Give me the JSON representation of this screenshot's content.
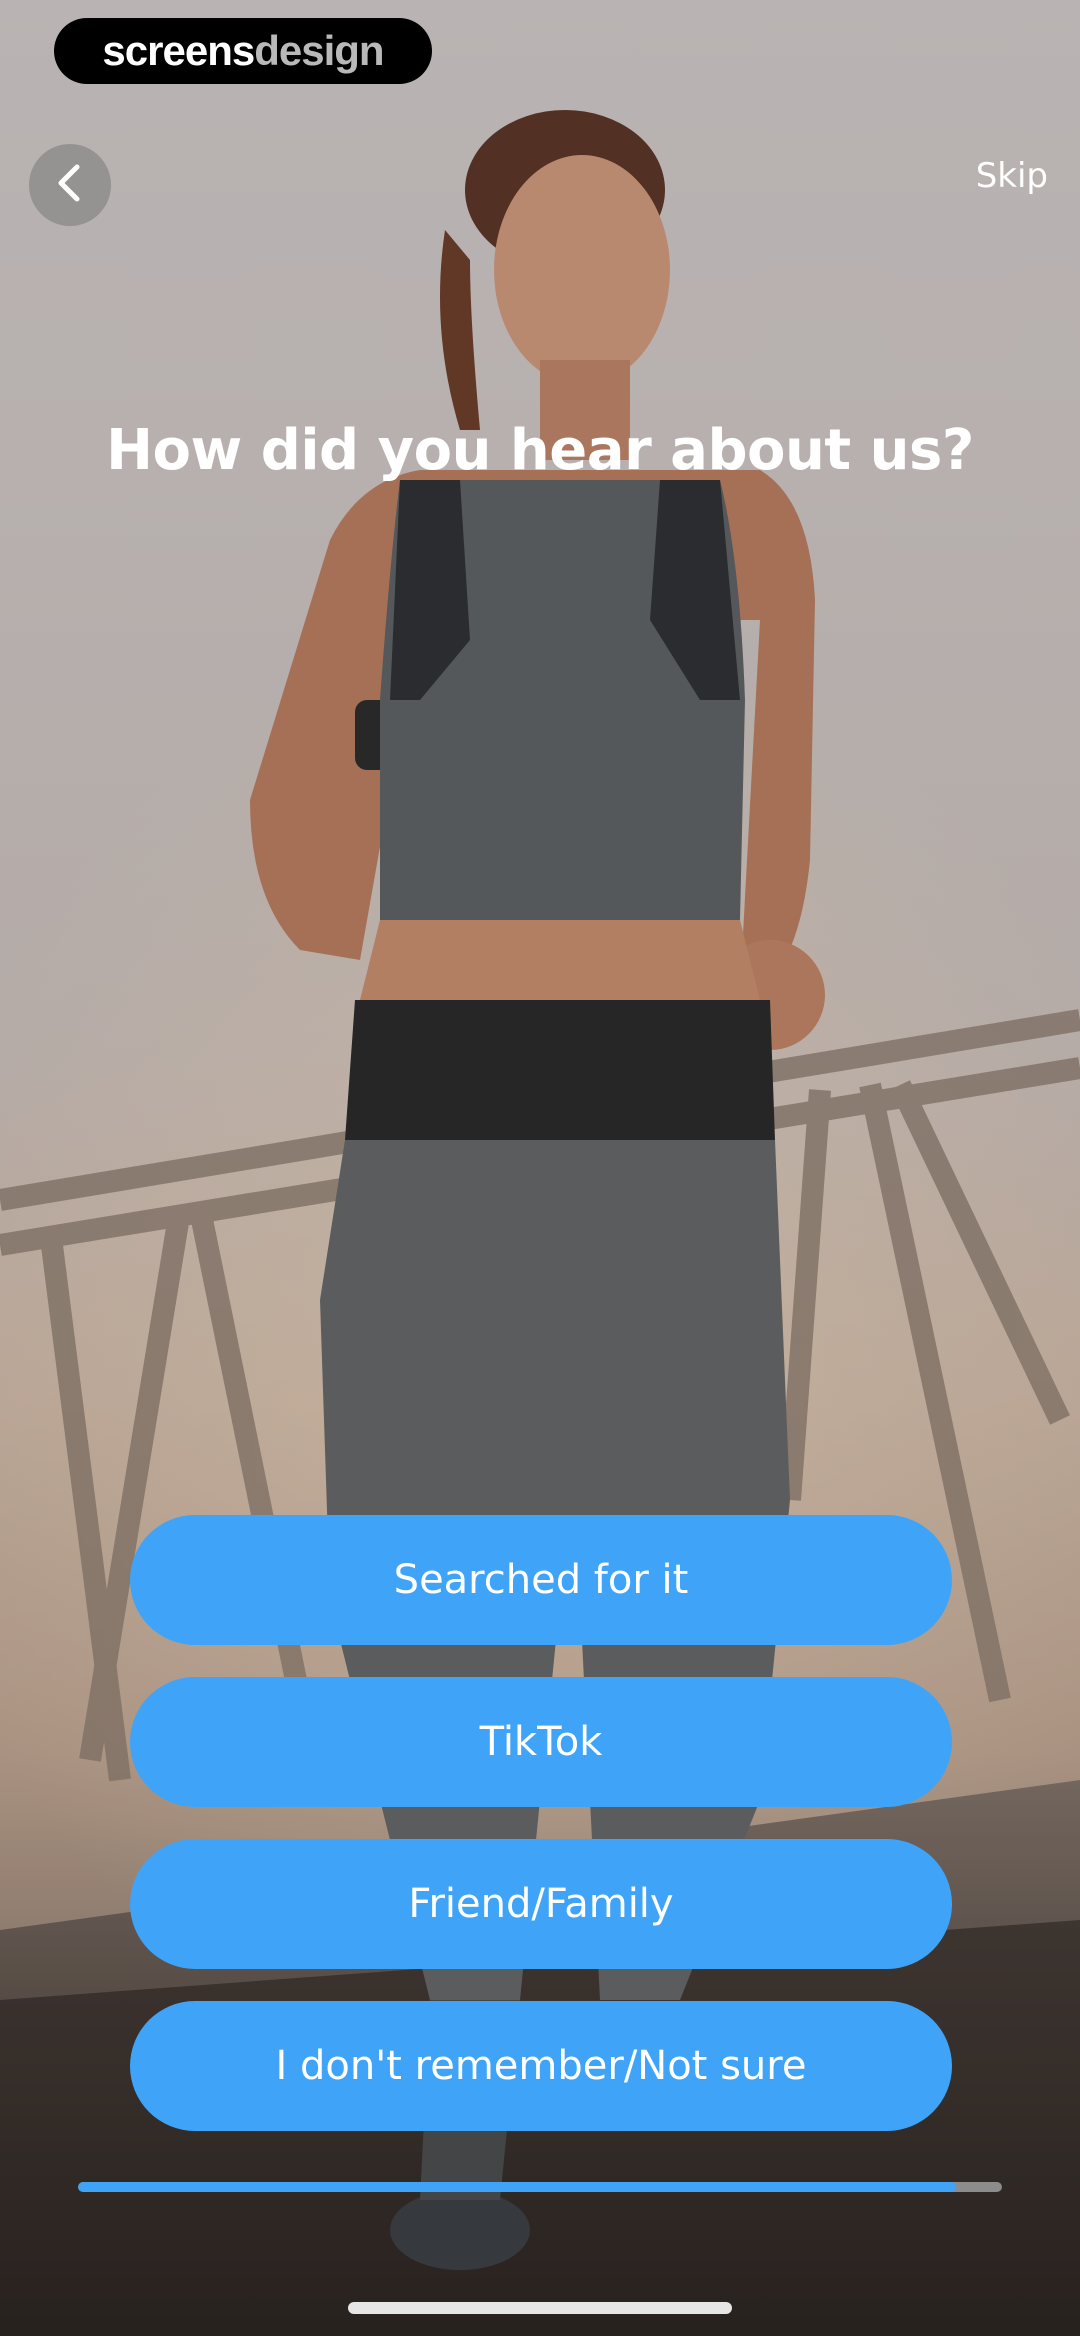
{
  "watermark": {
    "part1": "screens",
    "part2": "design"
  },
  "nav": {
    "back_icon": "chevron-left-icon",
    "skip_label": "Skip"
  },
  "question": {
    "title": "How did you hear about us?"
  },
  "options": [
    {
      "label": "Searched for it"
    },
    {
      "label": "TikTok"
    },
    {
      "label": "Friend/Family"
    },
    {
      "label": "I don't remember/Not sure"
    }
  ],
  "progress": {
    "fraction": 0.95
  },
  "colors": {
    "accent": "#3fa4f7",
    "track": "#8c8c8c",
    "text": "#ffffff"
  }
}
